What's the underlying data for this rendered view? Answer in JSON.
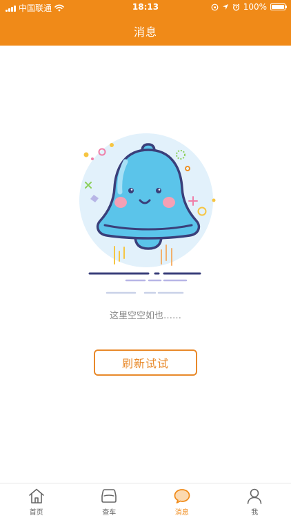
{
  "status_bar": {
    "carrier": "中国联通",
    "time": "18:13",
    "battery": "100%",
    "battery_level": 1.0
  },
  "header": {
    "title": "消息"
  },
  "empty_state": {
    "message": "这里空空如也……",
    "refresh_label": "刷新试试"
  },
  "tab_bar": {
    "items": [
      {
        "label": "首页",
        "icon": "home-icon",
        "active": false
      },
      {
        "label": "查车",
        "icon": "car-icon",
        "active": false
      },
      {
        "label": "消息",
        "icon": "chat-bubble-icon",
        "active": true
      },
      {
        "label": "我",
        "icon": "user-icon",
        "active": false
      }
    ]
  },
  "colors": {
    "brand": "#f08a18",
    "button_accent": "#e8892a",
    "bell": "#5bc4ea",
    "bell_outline": "#3a3f7a",
    "tab_inactive": "#666666"
  }
}
